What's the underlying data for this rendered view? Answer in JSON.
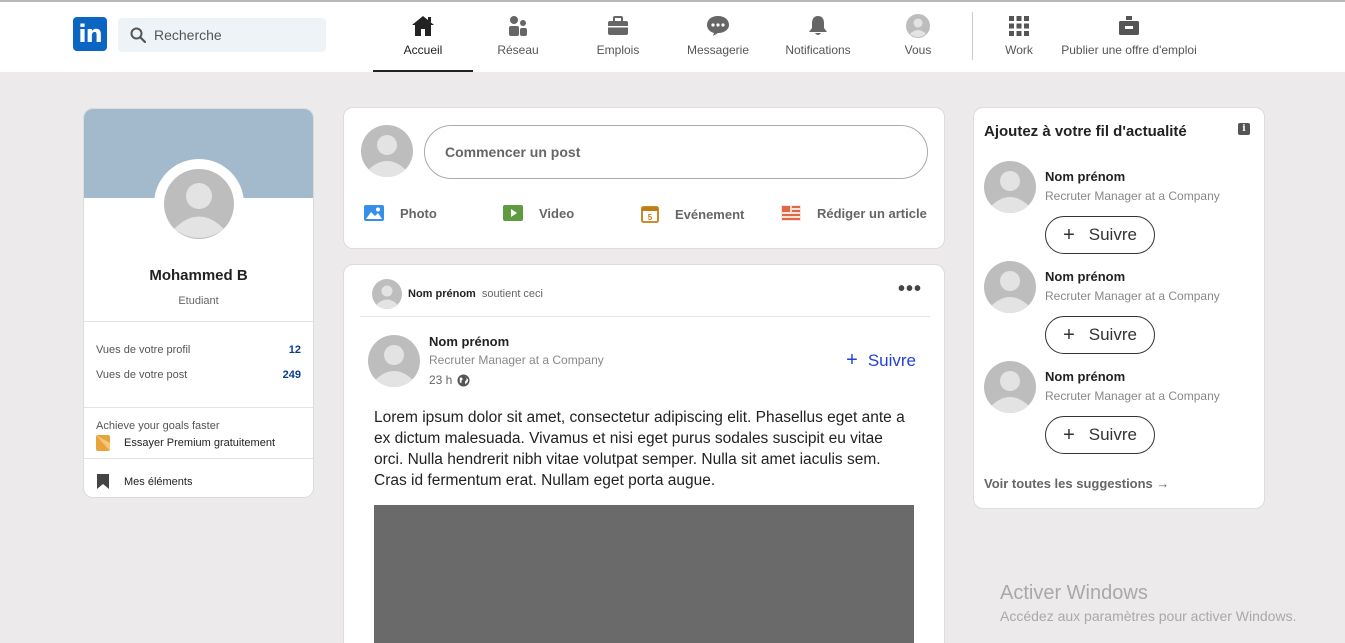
{
  "header": {
    "logo": "in",
    "search_placeholder": "Recherche",
    "nav": [
      {
        "label": "Accueil",
        "icon": "home-icon"
      },
      {
        "label": "Réseau",
        "icon": "network-icon"
      },
      {
        "label": "Emplois",
        "icon": "briefcase-icon"
      },
      {
        "label": "Messagerie",
        "icon": "message-icon"
      },
      {
        "label": "Notifications",
        "icon": "bell-icon"
      },
      {
        "label": "Vous",
        "icon": "avatar-icon"
      },
      {
        "label": "Work",
        "icon": "grid-icon"
      },
      {
        "label": "Publier une offre d'emploi",
        "icon": "job-post-icon"
      }
    ]
  },
  "profile": {
    "name": "Mohammed B",
    "role": "Etudiant",
    "stats": [
      {
        "label": "Vues de votre profil",
        "value": "12"
      },
      {
        "label": "Vues de votre post",
        "value": "249"
      }
    ],
    "premium_hint": "Achieve your goals faster",
    "premium_cta": "Essayer Premium gratuitement",
    "saved": "Mes éléments"
  },
  "composer": {
    "placeholder": "Commencer un post",
    "actions": [
      {
        "label": "Photo",
        "icon": "photo-icon",
        "color": "#378fe9"
      },
      {
        "label": "Video",
        "icon": "video-icon",
        "color": "#5f9b41"
      },
      {
        "label": "Evénement",
        "icon": "calendar-icon",
        "color": "#c37d16"
      },
      {
        "label": "Rédiger un article",
        "icon": "article-icon",
        "color": "#e06847"
      }
    ]
  },
  "post": {
    "supporter_name": "Nom prénom",
    "supporter_action": "soutient ceci",
    "author_name": "Nom prénom",
    "author_title": "Recruter Manager at a Company",
    "time": "23 h",
    "follow_label": "Suivre",
    "text": "Lorem ipsum dolor sit amet, consectetur adipiscing elit. Phasellus eget ante a ex dictum malesuada. Vivamus et nisi eget purus sodales suscipit eu vitae orci. Nulla hendrerit nibh vitae volutpat semper. Nulla sit amet iaculis sem. Cras id fermentum erat. Nullam eget porta augue."
  },
  "suggestions": {
    "title": "Ajoutez à votre fil d'actualité",
    "items": [
      {
        "name": "Nom prénom",
        "title": "Recruter Manager at a Company",
        "button": "Suivre"
      },
      {
        "name": "Nom prénom",
        "title": "Recruter Manager at a Company",
        "button": "Suivre"
      },
      {
        "name": "Nom prénom",
        "title": "Recruter Manager at a Company",
        "button": "Suivre"
      }
    ],
    "see_all": "Voir toutes les suggestions →"
  },
  "watermark": {
    "title": "Activer Windows",
    "subtitle": "Accédez aux paramètres pour activer Windows."
  }
}
